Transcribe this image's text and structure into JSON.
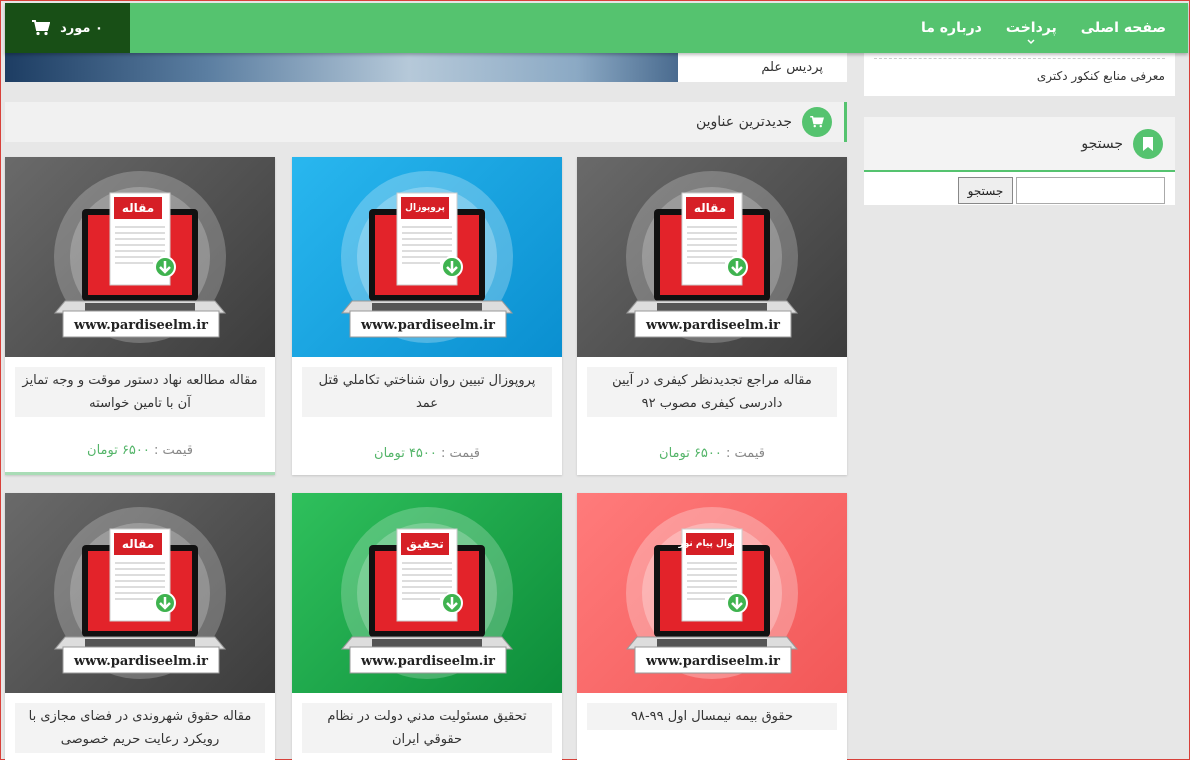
{
  "nav": {
    "items": [
      "صفحه اصلی",
      "پرداخت",
      "درباره ما"
    ],
    "cart_label": "۰ مورد"
  },
  "banner": {
    "caption": "پردیس علم"
  },
  "sidebar": {
    "link": "معرفی منابع کنکور دکتری",
    "search_title": "جستجو",
    "search_button": "جستجو",
    "search_value": ""
  },
  "section": {
    "title": "جدیدترین عناوین"
  },
  "price_prefix": "قیمت :",
  "products": [
    {
      "badge": "مقاله",
      "bg": "gray",
      "site": "www.pardiseelm.ir",
      "title": "مقاله مراجع تجدیدنظر کیفری در آیین دادرسی کیفری مصوب ۹۲",
      "price": "۶۵۰۰ تومان"
    },
    {
      "badge": "پروپوزال",
      "bg": "blue",
      "site": "www.pardiseelm.ir",
      "title": "پروپوزال تبيين روان شناختي تكاملي قتل عمد",
      "price": "۴۵۰۰ تومان"
    },
    {
      "badge": "مقاله",
      "bg": "gray",
      "site": "www.pardiseelm.ir",
      "title": "مقاله مطالعه نهاد دستور موقت و وجه تمایز آن با تامین خواسته",
      "price": "۶۵۰۰ تومان"
    },
    {
      "badge": "سوال پیام نور",
      "bg": "red",
      "site": "www.pardiseelm.ir",
      "title": "حقوق بیمه نیمسال اول ۹۹-۹۸",
      "price": ""
    },
    {
      "badge": "تحقیق",
      "bg": "green",
      "site": "www.pardiseelm.ir",
      "title": "تحقیق مسئوليت مدني دولت در نظام حقوقي ايران",
      "price": ""
    },
    {
      "badge": "مقاله",
      "bg": "gray",
      "site": "www.pardiseelm.ir",
      "title": "مقاله حقوق شهروندی در فضای مجازی با رویکرد رعایت حریم خصوصی",
      "price": ""
    }
  ],
  "colors": {
    "accent": "#55c36f",
    "cart_bg": "#184f16",
    "price": "#55b56a"
  }
}
